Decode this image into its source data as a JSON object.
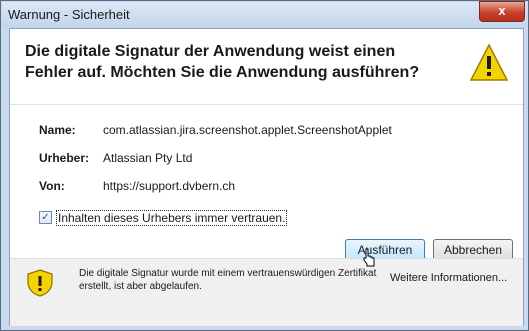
{
  "window": {
    "title": "Warnung - Sicherheit",
    "close_label": "x"
  },
  "header": {
    "title": "Die digitale Signatur der Anwendung weist einen Fehler auf.  Möchten Sie die Anwendung ausführen?",
    "icon": "warning-triangle-icon"
  },
  "details": {
    "name_label": "Name:",
    "name_value": "com.atlassian.jira.screenshot.applet.ScreenshotApplet",
    "publisher_label": "Urheber:",
    "publisher_value": "Atlassian Pty Ltd",
    "from_label": "Von:",
    "from_value": "https://support.dvbern.ch"
  },
  "trust_checkbox": {
    "checked": true,
    "label": "Inhalten dieses Urhebers immer vertrauen."
  },
  "buttons": {
    "run": "Ausführen",
    "cancel": "Abbrechen"
  },
  "footer": {
    "icon": "shield-warning-icon",
    "message": "Die digitale Signatur wurde mit einem vertrauenswürdigen Zertifikat erstellt, ist aber abgelaufen.",
    "more_info": "Weitere Informationen..."
  },
  "colors": {
    "titlebar": "#c9daee",
    "close_button": "#c7412b",
    "warning_yellow": "#f5d300",
    "primary_button": "#bee6fd"
  }
}
